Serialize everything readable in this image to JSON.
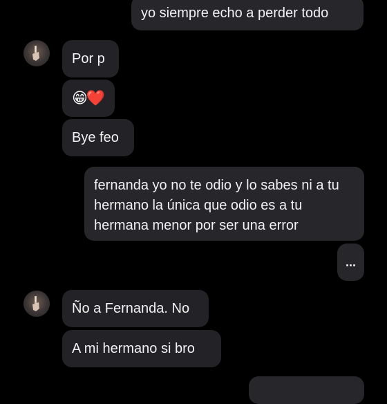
{
  "messages": {
    "m1": "yo siempre echo a perder todo",
    "m2": "Por p",
    "m3": "😁❤️",
    "m4": "Bye feo",
    "m5": "fernanda yo no te odio y lo sabes ni a tu hermano la única que odio es a tu hermana menor por ser una error",
    "m6": "...",
    "m7": "Ño a Fernanda. No",
    "m8": "A mi hermano si bro"
  },
  "colors": {
    "background": "#000000",
    "incoming_bubble": "#232327",
    "outgoing_bubble": "#26262b",
    "text": "#f2f2f2"
  },
  "icons": {
    "avatar": "contact-avatar-icon"
  }
}
